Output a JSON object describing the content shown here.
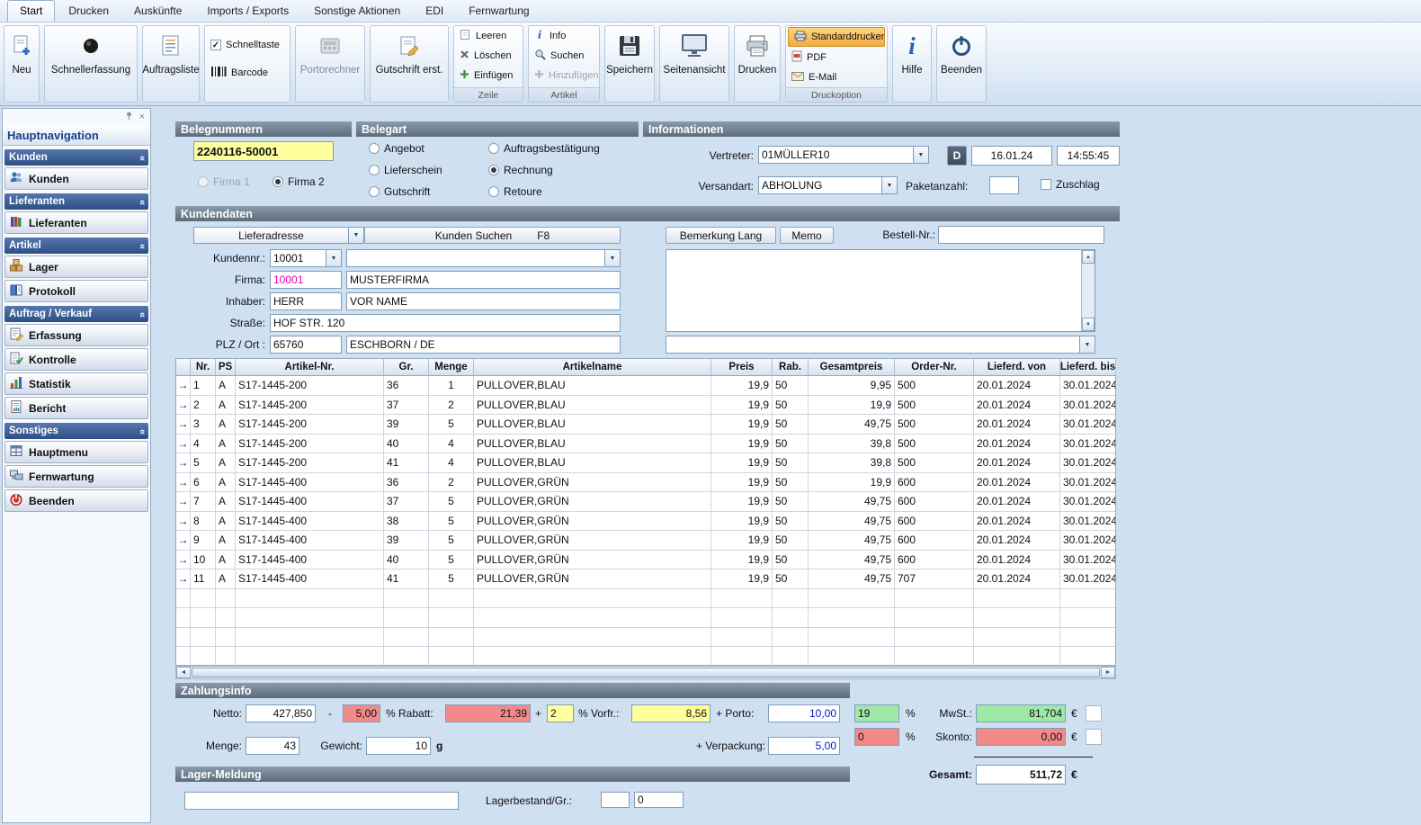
{
  "tabs": [
    {
      "label": "Start"
    },
    {
      "label": "Drucken"
    },
    {
      "label": "Auskünfte"
    },
    {
      "label": "Imports / Exports"
    },
    {
      "label": "Sonstige Aktionen"
    },
    {
      "label": "EDI"
    },
    {
      "label": "Fernwartung"
    }
  ],
  "ribbon": {
    "neu": "Neu",
    "schnellerfassung": "Schnellerfassung",
    "auftragsliste": "Auftragsliste",
    "schnelltaste": "Schnelltaste",
    "barcode": "Barcode",
    "portorechner": "Portorechner",
    "gutschrift_erst": "Gutschrift erst.",
    "leeren": "Leeren",
    "loeschen": "Löschen",
    "einfuegen": "Einfügen",
    "zeile_caption": "Zeile",
    "info": "Info",
    "suchen": "Suchen",
    "hinzufuegen": "Hinzufügen",
    "artikel_caption": "Artikel",
    "speichern": "Speichern",
    "seitenansicht": "Seitenansicht",
    "drucken": "Drucken",
    "standarddrucker": "Standarddrucker",
    "pdf": "PDF",
    "email": "E-Mail",
    "druckoption_caption": "Druckoption",
    "hilfe": "Hilfe",
    "beenden": "Beenden"
  },
  "sidebar": {
    "title": "Hauptnavigation",
    "sections": [
      {
        "label": "Kunden",
        "items": [
          {
            "label": "Kunden"
          }
        ]
      },
      {
        "label": "Lieferanten",
        "items": [
          {
            "label": "Lieferanten"
          }
        ]
      },
      {
        "label": "Artikel",
        "items": [
          {
            "label": "Lager"
          },
          {
            "label": "Protokoll"
          }
        ]
      },
      {
        "label": "Auftrag / Verkauf",
        "items": [
          {
            "label": "Erfassung"
          },
          {
            "label": "Kontrolle"
          },
          {
            "label": "Statistik"
          },
          {
            "label": "Bericht"
          }
        ]
      },
      {
        "label": "Sonstiges",
        "items": [
          {
            "label": "Hauptmenu"
          },
          {
            "label": "Fernwartung"
          },
          {
            "label": "Beenden"
          }
        ]
      }
    ]
  },
  "belegnummern": {
    "title": "Belegnummern",
    "nummer": "2240116-50001",
    "firma1": "Firma 1",
    "firma2": "Firma 2",
    "selected_firma": "Firma 2"
  },
  "belegart": {
    "title": "Belegart",
    "options": [
      "Angebot",
      "Lieferschein",
      "Gutschrift",
      "Auftragsbestätigung",
      "Rechnung",
      "Retoure"
    ],
    "selected": "Rechnung"
  },
  "informationen": {
    "title": "Informationen",
    "vertreter_label": "Vertreter:",
    "vertreter": "01MÜLLER10",
    "d_button": "D",
    "date": "16.01.24",
    "time": "14:55:45",
    "versandart_label": "Versandart:",
    "versandart": "ABHOLUNG",
    "paketanzahl_label": "Paketanzahl:",
    "paketanzahl": "",
    "zuschlag_label": "Zuschlag"
  },
  "kundendaten": {
    "title": "Kundendaten",
    "lieferadresse_button": "Lieferadresse",
    "kunden_suchen_button": "Kunden Suchen",
    "f8": "F8",
    "kundennr_label": "Kundennr.:",
    "kundennr": "10001",
    "kundennr2": "",
    "firma_label": "Firma:",
    "firma_nr": "10001",
    "firma_name": "MUSTERFIRMA",
    "inhaber_label": "Inhaber:",
    "inhaber_anrede": "HERR",
    "inhaber_name": "VOR NAME",
    "strasse_label": "Straße:",
    "strasse": "HOF STR. 120",
    "plz_label": "PLZ / Ort :",
    "plz": "65760",
    "ort": "ESCHBORN / DE",
    "bemerkung_button": "Bemerkung Lang",
    "memo_button": "Memo",
    "bestellnr_label": "Bestell-Nr.:",
    "bestellnr": "",
    "memo_text": ""
  },
  "table": {
    "columns": [
      "Nr.",
      "PS",
      "Artikel-Nr.",
      "Gr.",
      "Menge",
      "Artikelname",
      "Preis",
      "Rab.",
      "Gesamtpreis",
      "Order-Nr.",
      "Lieferd. von",
      "Lieferd. bis"
    ],
    "rows": [
      [
        "1",
        "A",
        "S17-1445-200",
        "36",
        "1",
        "PULLOVER,BLAU",
        "19,9",
        "50",
        "9,95",
        "500",
        "20.01.2024",
        "30.01.2024"
      ],
      [
        "2",
        "A",
        "S17-1445-200",
        "37",
        "2",
        "PULLOVER,BLAU",
        "19,9",
        "50",
        "19,9",
        "500",
        "20.01.2024",
        "30.01.2024"
      ],
      [
        "3",
        "A",
        "S17-1445-200",
        "39",
        "5",
        "PULLOVER,BLAU",
        "19,9",
        "50",
        "49,75",
        "500",
        "20.01.2024",
        "30.01.2024"
      ],
      [
        "4",
        "A",
        "S17-1445-200",
        "40",
        "4",
        "PULLOVER,BLAU",
        "19,9",
        "50",
        "39,8",
        "500",
        "20.01.2024",
        "30.01.2024"
      ],
      [
        "5",
        "A",
        "S17-1445-200",
        "41",
        "4",
        "PULLOVER,BLAU",
        "19,9",
        "50",
        "39,8",
        "500",
        "20.01.2024",
        "30.01.2024"
      ],
      [
        "6",
        "A",
        "S17-1445-400",
        "36",
        "2",
        "PULLOVER,GRÜN",
        "19,9",
        "50",
        "19,9",
        "600",
        "20.01.2024",
        "30.01.2024"
      ],
      [
        "7",
        "A",
        "S17-1445-400",
        "37",
        "5",
        "PULLOVER,GRÜN",
        "19,9",
        "50",
        "49,75",
        "600",
        "20.01.2024",
        "30.01.2024"
      ],
      [
        "8",
        "A",
        "S17-1445-400",
        "38",
        "5",
        "PULLOVER,GRÜN",
        "19,9",
        "50",
        "49,75",
        "600",
        "20.01.2024",
        "30.01.2024"
      ],
      [
        "9",
        "A",
        "S17-1445-400",
        "39",
        "5",
        "PULLOVER,GRÜN",
        "19,9",
        "50",
        "49,75",
        "600",
        "20.01.2024",
        "30.01.2024"
      ],
      [
        "10",
        "A",
        "S17-1445-400",
        "40",
        "5",
        "PULLOVER,GRÜN",
        "19,9",
        "50",
        "49,75",
        "600",
        "20.01.2024",
        "30.01.2024"
      ],
      [
        "11",
        "A",
        "S17-1445-400",
        "41",
        "5",
        "PULLOVER,GRÜN",
        "19,9",
        "50",
        "49,75",
        "707",
        "20.01.2024",
        "30.01.2024"
      ]
    ],
    "empty_rows": 4
  },
  "zahlungsinfo": {
    "title": "Zahlungsinfo",
    "netto_label": "Netto:",
    "netto": "427,850",
    "minus": "-",
    "rabatt_pct": "5,00",
    "rabatt_label": "% Rabatt:",
    "rabatt": "21,39",
    "plus": "+",
    "vorfr_pct": "2",
    "vorfr_label": "% Vorfr.:",
    "vorfr": "8,56",
    "porto_label": "+ Porto:",
    "porto": "10,00",
    "menge_label": "Menge:",
    "menge": "43",
    "gewicht_label": "Gewicht:",
    "gewicht": "10",
    "gewicht_unit": "g",
    "verpackung_label": "+ Verpackung:",
    "verpackung": "5,00",
    "mwst_pct": "19",
    "percent": "%",
    "mwst_label": "MwSt.:",
    "mwst": "81,704",
    "euro": "€",
    "skonto_pct": "0",
    "skonto_label": "Skonto:",
    "skonto": "0,00",
    "gesamt_label": "Gesamt:",
    "gesamt": "511,72"
  },
  "lager": {
    "title": "Lager-Meldung",
    "meldung": "",
    "bestand_label": "Lagerbestand/Gr.:",
    "bestand_gr": "",
    "bestand": "0"
  },
  "colors": {
    "highlight_yellow": "#ffff9e",
    "alert_red": "#f28a8a",
    "ok_green": "#9fe8a8",
    "selected_orange": "#f3ab42",
    "value_magenta": "#e500b4",
    "amount_blue": "#0018c8"
  }
}
